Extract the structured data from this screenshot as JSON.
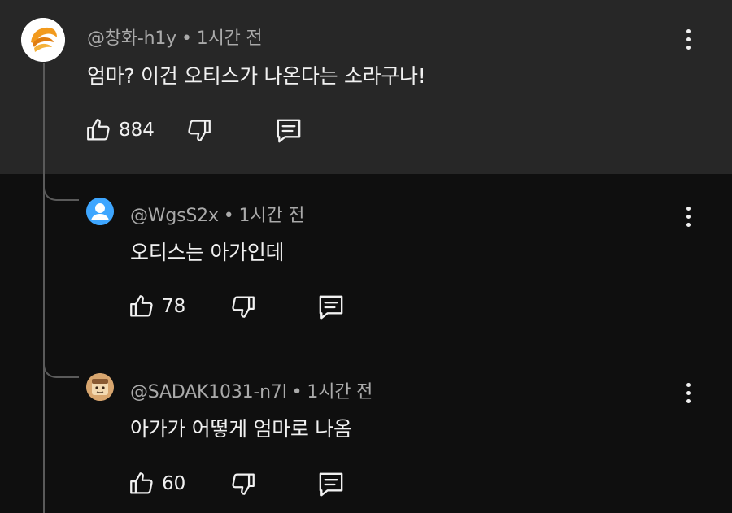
{
  "comments": [
    {
      "author": "@창화-h1y",
      "time": "1시간 전",
      "separator": "•",
      "text": "엄마? 이건 오티스가 나온다는 소라구나!",
      "likes": "884",
      "avatar_icon": "sun-orange-icon"
    },
    {
      "author": "@WgsS2x",
      "time": "1시간 전",
      "separator": "•",
      "text": "오티스는 아가인데",
      "likes": "78",
      "avatar_icon": "default-user-icon"
    },
    {
      "author": "@SADAK1031-n7l",
      "time": "1시간 전",
      "separator": "•",
      "text": "아가가 어떻게 엄마로 나옴",
      "likes": "60",
      "avatar_icon": "character-avatar-icon"
    }
  ],
  "colors": {
    "highlight_bg": "#272727",
    "page_bg": "#0f0f0f",
    "meta_text": "#aaaaaa",
    "primary_text": "#f1f1f1"
  }
}
